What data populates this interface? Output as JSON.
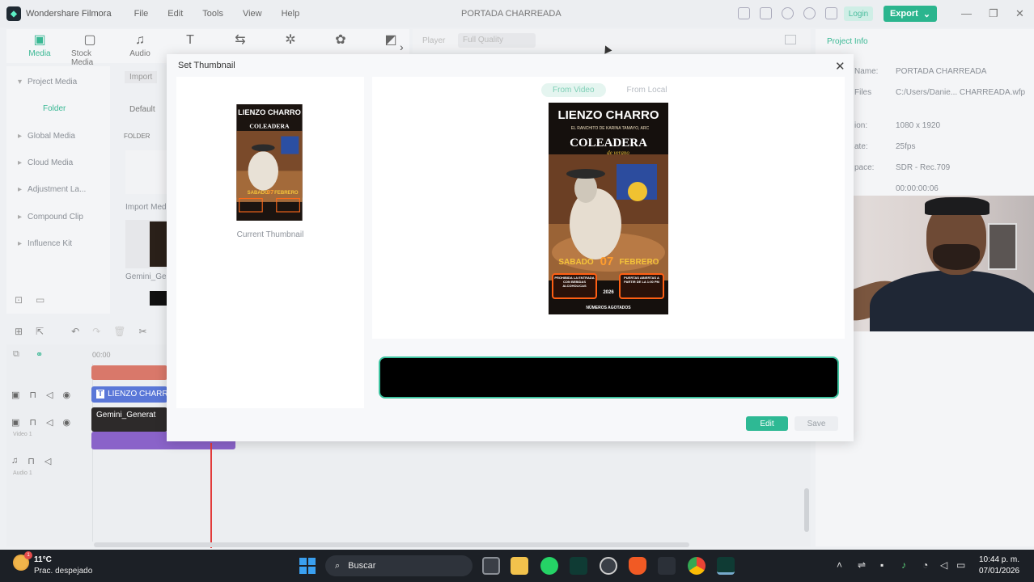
{
  "titlebar": {
    "app_name": "Wondershare Filmora",
    "menu": [
      "File",
      "Edit",
      "Tools",
      "View",
      "Help"
    ],
    "project_title": "PORTADA CHARREADA",
    "login": "Login",
    "export": "Export"
  },
  "toolbar": {
    "tools": [
      {
        "label": "Media",
        "icon": "media-icon",
        "glyph": "▣"
      },
      {
        "label": "Stock Media",
        "icon": "stock-media-icon",
        "glyph": "▢"
      },
      {
        "label": "Audio",
        "icon": "audio-icon",
        "glyph": "♫"
      },
      {
        "label": "",
        "icon": "titles-icon",
        "glyph": "T"
      },
      {
        "label": "",
        "icon": "transitions-icon",
        "glyph": "⇆"
      },
      {
        "label": "",
        "icon": "effects-icon",
        "glyph": "✲"
      },
      {
        "label": "",
        "icon": "elements-icon",
        "glyph": "✿"
      },
      {
        "label": "",
        "icon": "split-screen-icon",
        "glyph": "◩"
      }
    ]
  },
  "sidebar": {
    "items": [
      "Project Media",
      "Global Media",
      "Cloud Media",
      "Adjustment La...",
      "Compound Clip",
      "Influence Kit"
    ],
    "folder": "Folder"
  },
  "media": {
    "import": "Import",
    "default": "Default",
    "folder_label": "FOLDER",
    "import_media": "Import Med",
    "gemini_label": "Gemini_Ge"
  },
  "player": {
    "label": "Player",
    "quality": "Full Quality"
  },
  "project_info": {
    "tab": "Project Info",
    "rows": [
      {
        "key": "Name:",
        "value": "PORTADA CHARREADA"
      },
      {
        "key": "Files",
        "value": "C:/Users/Danie... CHARREADA.wfp"
      },
      {
        "key": "ion:",
        "value": "1080 x 1920"
      },
      {
        "key": "ate:",
        "value": "25fps"
      },
      {
        "key": "pace:",
        "value": "SDR - Rec.709"
      },
      {
        "key": "",
        "value": "00:00:00:06"
      }
    ]
  },
  "timeline": {
    "ruler_start": "00:00",
    "text_clip": "LIENZO CHARRO",
    "video_clip": "Gemini_Generat",
    "video_track": "Video 1",
    "audio_track": "Audio 1"
  },
  "modal": {
    "title": "Set Thumbnail",
    "current_thumbnail_label": "Current Thumbnail",
    "tab_from_video": "From Video",
    "tab_from_local": "From Local",
    "edit": "Edit",
    "save": "Save",
    "poster": {
      "title": "LIENZO CHARRO",
      "subtitle": "EL RANCHITO DE KARINA TAMAYO, ARC",
      "event": "COLEADERA",
      "tag": "de verano",
      "day": "SABADO",
      "date_num": "07",
      "month": "FEBRERO",
      "left_box": "PROHIBIDA LA ENTRADA CON BEBIDAS ALCOHOLICAS",
      "right_box": "PUERTAS ABIERTAS A PARTIR DE LA 1:00 PM",
      "year": "2026",
      "footer": "NÚMEROS AGOTADOS"
    }
  },
  "taskbar": {
    "temp": "11°C",
    "weather": "Prac. despejado",
    "weather_badge": "1",
    "search": "Buscar",
    "time": "10:44 p. m.",
    "date": "07/01/2026"
  },
  "colors": {
    "accent": "#2bb58e",
    "timeline_text_clip": "#5a77d8",
    "timeline_video_clip": "#8a63c9",
    "timeline_audio_clip": "#d9786a"
  }
}
